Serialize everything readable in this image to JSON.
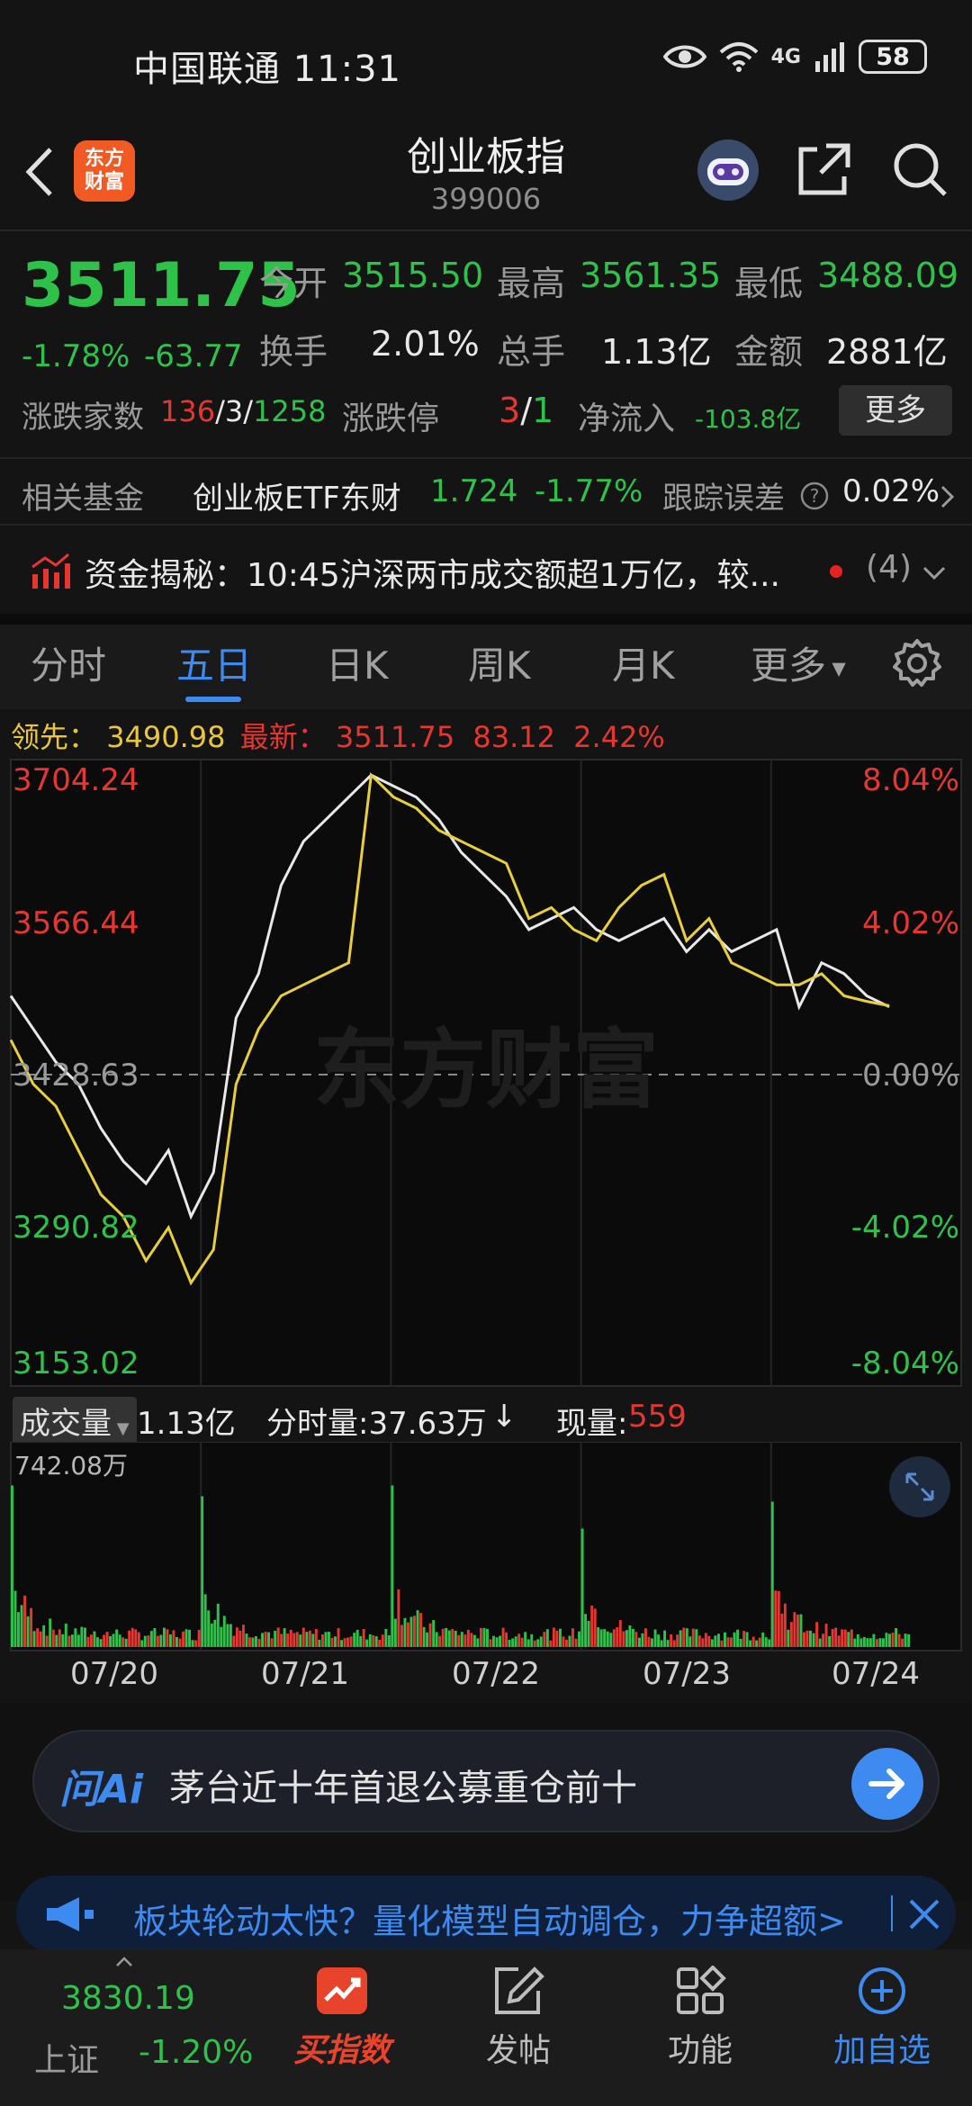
{
  "status_bar": {
    "carrier_time": "中国联通 11:31",
    "network": "4G",
    "battery": "58"
  },
  "header": {
    "title": "创业板指",
    "code": "399006",
    "logo_text": "东方财富"
  },
  "quote": {
    "price": "3511.75",
    "change_pct": "-1.78%",
    "change_abs": "-63.77",
    "open_label": "今开",
    "open": "3515.50",
    "high_label": "最高",
    "high": "3561.35",
    "low_label": "最低",
    "low": "3488.09",
    "turnover_label": "换手",
    "turnover": "2.01%",
    "volume_label": "总手",
    "volume": "1.13亿",
    "amount_label": "金额",
    "amount": "2881亿",
    "breadth_label": "涨跌家数",
    "breadth_up": "136",
    "breadth_flat": "3",
    "breadth_down": "1258",
    "limit_label": "涨跌停",
    "limit_up": "3",
    "limit_down": "1",
    "netflow_label": "净流入",
    "netflow": "-103.8亿",
    "more_label": "更多"
  },
  "fund": {
    "label": "相关基金",
    "name": "创业板ETF东财",
    "price": "1.724",
    "change": "-1.77%",
    "tracking_label": "跟踪误差",
    "tracking_value": "0.02%"
  },
  "news": {
    "text": "资金揭秘：10:45沪深两市成交额超1万亿，较...",
    "count": "(4)"
  },
  "tabs": [
    "分时",
    "五日",
    "日K",
    "周K",
    "月K",
    "更多"
  ],
  "active_tab": 1,
  "chart_info": {
    "lead_label": "领先：",
    "lead_value": "3490.98",
    "latest_label": "最新：",
    "latest_value": "3511.75",
    "latest_change": "83.12",
    "latest_pct": "2.42%"
  },
  "volume_header": {
    "label": "成交量",
    "total": "1.13亿",
    "minute_label": "分时量:37.63万",
    "current_label": "现量:",
    "current_value": "559"
  },
  "ai": {
    "logo": "问Ai",
    "query": "茅台近十年首退公募重仓前十"
  },
  "banner": {
    "text": "板块轮动太快？量化模型自动调仓，力争超额>"
  },
  "bottom_nav": {
    "index_value": "3830.19",
    "index_name": "上证",
    "index_change": "-1.20%",
    "buy_label": "买指数",
    "post_label": "发帖",
    "func_label": "功能",
    "add_label": "加自选"
  },
  "chart_data": [
    {
      "type": "line",
      "title": "",
      "categories": [
        "07/20",
        "07/21",
        "07/22",
        "07/23",
        "07/24"
      ],
      "y_ticks_left": [
        "3704.24",
        "3566.44",
        "3428.63",
        "3290.82",
        "3153.02"
      ],
      "y_ticks_right": [
        "8.04%",
        "4.02%",
        "0.00%",
        "-4.02%",
        "-8.04%"
      ],
      "ylim": [
        3153.02,
        3704.24
      ],
      "reference_line": 3428.63,
      "watermark": "东方财富",
      "colors": {
        "price": "#e8e8e8",
        "lead": "#e8cf3a"
      },
      "series": [
        {
          "name": "最新",
          "color": "#e8e8e8",
          "values": [
            3500,
            3470,
            3440,
            3420,
            3380,
            3350,
            3330,
            3360,
            3300,
            3340,
            3480,
            3520,
            3600,
            3640,
            3660,
            3680,
            3700,
            3690,
            3680,
            3660,
            3630,
            3610,
            3590,
            3560,
            3570,
            3580,
            3560,
            3550,
            3560,
            3570,
            3540,
            3560,
            3540,
            3550,
            3560,
            3490,
            3530,
            3520,
            3500,
            3490
          ]
        },
        {
          "name": "领先",
          "color": "#e8cf3a",
          "values": [
            3460,
            3420,
            3400,
            3360,
            3320,
            3300,
            3260,
            3290,
            3240,
            3270,
            3420,
            3470,
            3500,
            3510,
            3520,
            3530,
            3700,
            3680,
            3670,
            3650,
            3640,
            3630,
            3620,
            3570,
            3580,
            3560,
            3550,
            3580,
            3600,
            3610,
            3550,
            3570,
            3530,
            3520,
            3510,
            3510,
            3520,
            3500,
            3495,
            3491
          ]
        }
      ]
    },
    {
      "type": "bar",
      "title": "",
      "categories": [
        "07/20",
        "07/21",
        "07/22",
        "07/23",
        "07/24"
      ],
      "y_max_label": "742.08万",
      "ylim": [
        0,
        742.08
      ],
      "spike_values": [
        600,
        560,
        600,
        440,
        540
      ],
      "colors": {
        "up": "#e5372f",
        "down": "#2fc24b"
      }
    }
  ]
}
